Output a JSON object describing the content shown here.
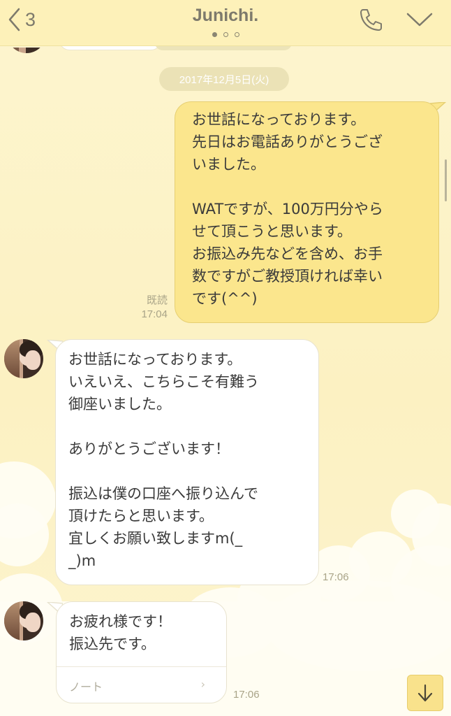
{
  "header": {
    "back_count": "3",
    "title": "Junichi.",
    "page_indicator": {
      "current": 1,
      "total": 3
    },
    "icons": [
      "chevron-left-icon",
      "phone-icon",
      "chevron-down-icon"
    ]
  },
  "date_separator": "2017年12月5日(火)",
  "messages": [
    {
      "direction": "sent",
      "text": "お世話になっております。\n先日はお電話ありがとうござ\nいました。\n\nWATですが、100万円分やら\nせて頂こうと思います。\nお振込み先などを含め、お手\n数ですがご教授頂ければ幸い\nです(^^)",
      "read_label": "既読",
      "time": "17:04"
    },
    {
      "direction": "received",
      "text": "お世話になっております。\nいえいえ、こちらこそ有難う\n御座いました。\n\nありがとうございます！\n\n振込は僕の口座へ振り込んで\n頂けたらと思います。\n宜しくお願い致しますm(_\n_)m",
      "time": "17:06"
    },
    {
      "direction": "received",
      "text": "お疲れ様です！\n振込先です。",
      "attachment_label": "ノート",
      "attachment_chevron": "›",
      "time": "17:06"
    }
  ],
  "colors": {
    "header_bg": "#fdf1b9",
    "chat_bg": "#fdf3c4",
    "sent_bubble": "#fbe68d",
    "received_bubble": "#ffffff"
  }
}
